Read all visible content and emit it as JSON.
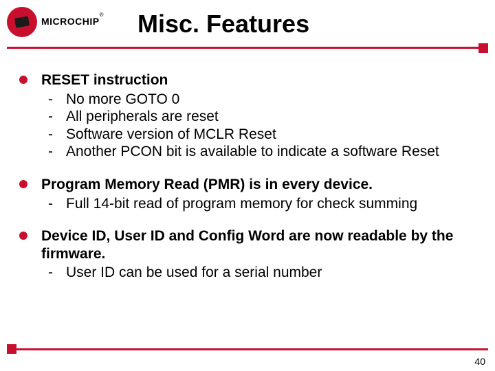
{
  "logo": {
    "brand": "MICROCHIP",
    "reg": "®"
  },
  "title": "Misc. Features",
  "bullets": [
    {
      "heading": "RESET instruction",
      "subs": [
        "No more GOTO 0",
        "All peripherals are reset",
        "Software version of MCLR Reset",
        "Another PCON bit is available to indicate a software Reset"
      ]
    },
    {
      "heading": "Program Memory Read (PMR) is in every device.",
      "subs": [
        "Full 14-bit read of program memory for check summing"
      ]
    },
    {
      "heading": "Device ID, User ID and Config Word are now readable by the firmware.",
      "subs": [
        "User ID can be used for a serial number"
      ]
    }
  ],
  "dash": "-",
  "pageNumber": "40"
}
